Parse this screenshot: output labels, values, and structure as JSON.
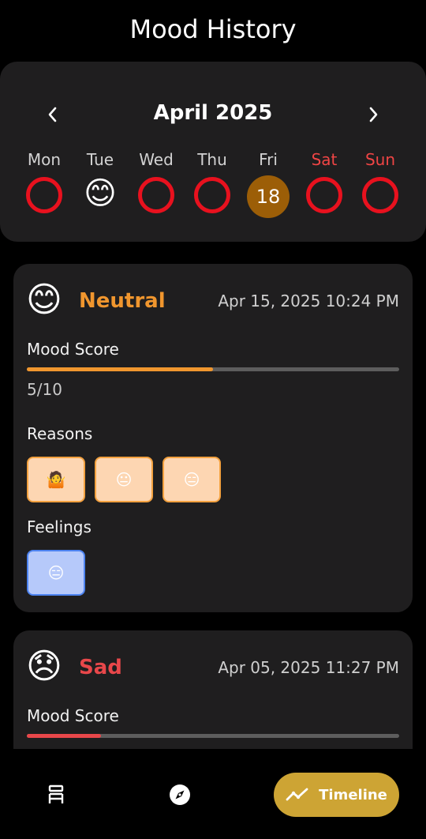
{
  "header": {
    "title": "Mood History"
  },
  "calendar": {
    "month": "April 2025",
    "days": [
      {
        "label": "Mon",
        "state": "empty",
        "weekend": false
      },
      {
        "label": "Tue",
        "state": "emoji",
        "emoji": "😊",
        "weekend": false
      },
      {
        "label": "Wed",
        "state": "empty",
        "weekend": false
      },
      {
        "label": "Thu",
        "state": "empty",
        "weekend": false
      },
      {
        "label": "Fri",
        "state": "today",
        "date": "18",
        "weekend": false
      },
      {
        "label": "Sat",
        "state": "empty",
        "weekend": true
      },
      {
        "label": "Sun",
        "state": "empty",
        "weekend": true
      }
    ]
  },
  "entries": [
    {
      "emoji": "😊",
      "mood": "Neutral",
      "mood_color": "#f0962e",
      "datetime": "Apr 15, 2025 10:24 PM",
      "mood_score_label": "Mood Score",
      "score": 5,
      "score_max": 10,
      "score_text": "5/10",
      "reasons_label": "Reasons",
      "reasons": [
        "🤷",
        "😐",
        "😑"
      ],
      "feelings_label": "Feelings",
      "feelings": [
        "😑"
      ]
    },
    {
      "emoji": "😞",
      "mood": "Sad",
      "mood_color": "#e8474a",
      "datetime": "Apr 05, 2025 11:27 PM",
      "mood_score_label": "Mood Score",
      "score": 2,
      "score_max": 10
    }
  ],
  "bottom_nav": {
    "active_label": "Timeline",
    "accent": "#cda434"
  }
}
